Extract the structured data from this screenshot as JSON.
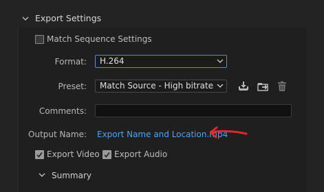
{
  "section": {
    "title": "Export Settings"
  },
  "match_sequence": {
    "label": "Match Sequence Settings",
    "checked": false
  },
  "format": {
    "label": "Format:",
    "value": "H.264"
  },
  "preset": {
    "label": "Preset:",
    "value": "Match Source - High bitrate"
  },
  "comments": {
    "label": "Comments:",
    "value": ""
  },
  "output_name": {
    "label": "Output Name:",
    "value": "Export Name and Location.mp4"
  },
  "export_video": {
    "label": "Export Video",
    "checked": true
  },
  "export_audio": {
    "label": "Export Audio",
    "checked": true
  },
  "summary": {
    "title": "Summary"
  },
  "colors": {
    "accent": "#4f8fd8",
    "link": "#4ea3f2",
    "annotation": "#e0282e"
  },
  "icons": [
    "chevron-down-icon",
    "download-preset-icon",
    "import-preset-icon",
    "trash-icon",
    "arrow-annotation"
  ]
}
